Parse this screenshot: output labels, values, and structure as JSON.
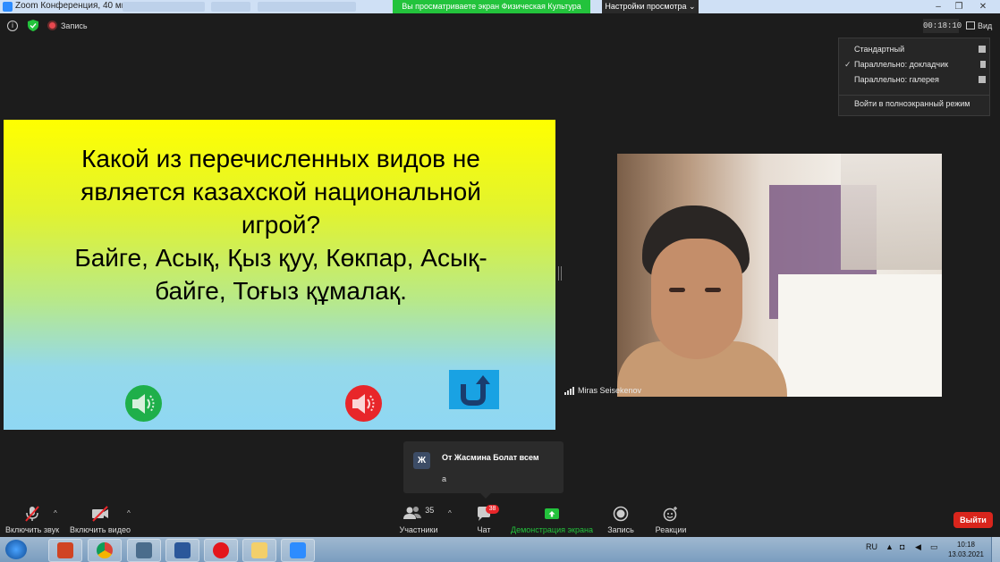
{
  "window": {
    "title": "Zoom Конференция, 40 мин",
    "share_banner": "Вы просматриваете экран Физическая Культура",
    "view_settings": "Настройки просмотра ⌄"
  },
  "topbar": {
    "record_label": "Запись",
    "timer": "00:18:10",
    "view_label": "Вид"
  },
  "view_menu": {
    "items": [
      {
        "label": "Стандартный",
        "checked": false
      },
      {
        "label": "Параллельно: докладчик",
        "checked": true
      },
      {
        "label": "Параллельно: галерея",
        "checked": false
      },
      {
        "label": "Войти в полноэкранный режим",
        "checked": false
      }
    ]
  },
  "slide": {
    "line1": "Какой из перечисленных видов не",
    "line2": "является казахской национальной",
    "line3": "игрой?",
    "line4": "Байге, Асық, Қыз қуу, Көкпар, Асық-",
    "line5": "байге, Тоғыз құмалақ."
  },
  "participant": {
    "name": "Miras Seisekenov"
  },
  "chat": {
    "avatar_letter": "Ж",
    "sender": "От Жасмина Болат всем",
    "message": "а"
  },
  "toolbar": {
    "audio_label": "Включить звук",
    "video_label": "Включить видео",
    "participants_label": "Участники",
    "participants_count": "35",
    "chat_label": "Чат",
    "chat_badge": "38",
    "share_label": "Демонстрация экрана",
    "record_label": "Запись",
    "reactions_label": "Реакции",
    "leave_label": "Выйти"
  },
  "taskbar": {
    "lang": "RU",
    "time": "10:18",
    "date": "13.03.2021"
  },
  "colors": {
    "share_green": "#23c33c",
    "leave_red": "#d9251c",
    "badge_red": "#e8262a"
  }
}
